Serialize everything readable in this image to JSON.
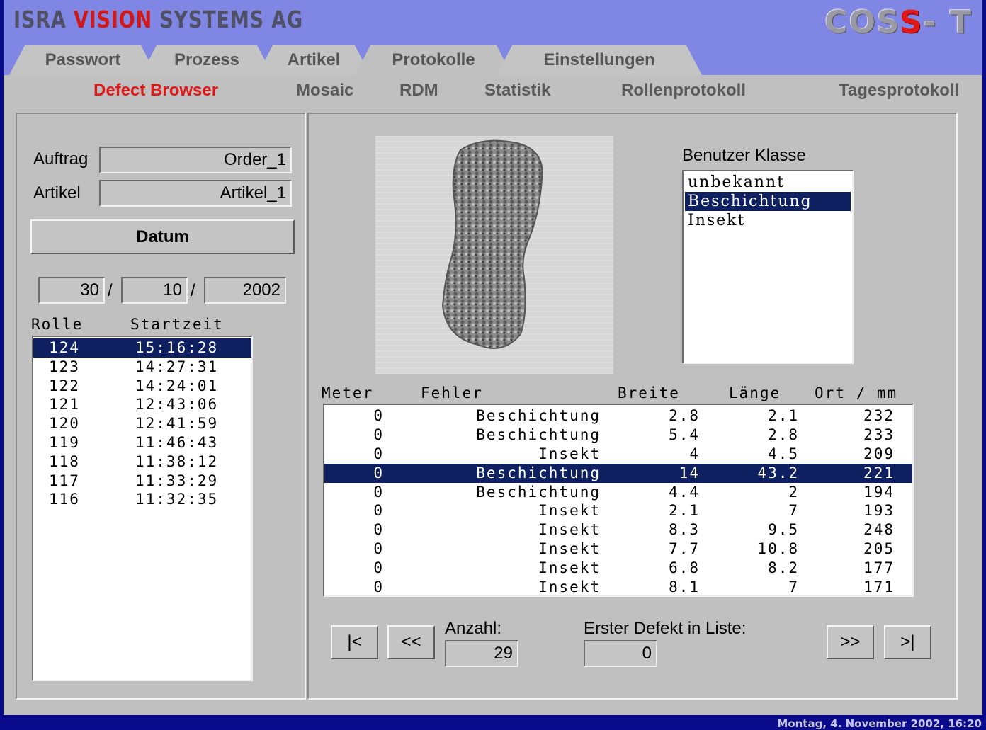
{
  "header": {
    "brand_part1": "ISRA ",
    "brand_part2": "VISION",
    "brand_part3": " SYSTEMS AG",
    "logo_cos": "COS",
    "logo_s": "S",
    "logo_t": "- T"
  },
  "tabs": [
    "Passwort",
    "Prozess",
    "Artikel",
    "Protokolle",
    "Einstellungen"
  ],
  "subnav": [
    "Defect Browser",
    "Mosaic",
    "RDM",
    "Statistik",
    "Rollenprotokoll",
    "Tagesprotokoll"
  ],
  "left": {
    "auftrag_label": "Auftrag",
    "auftrag_value": "Order_1",
    "artikel_label": "Artikel",
    "artikel_value": "Artikel_1",
    "datum_button": "Datum",
    "day": "30",
    "month": "10",
    "year": "2002",
    "sep": "/",
    "col_rolle": "Rolle",
    "col_startzeit": "Startzeit",
    "rolls": [
      {
        "rolle": "124",
        "start": "15:16:28"
      },
      {
        "rolle": "123",
        "start": "14:27:31"
      },
      {
        "rolle": "122",
        "start": "14:24:01"
      },
      {
        "rolle": "121",
        "start": "12:43:06"
      },
      {
        "rolle": "120",
        "start": "12:41:59"
      },
      {
        "rolle": "119",
        "start": "11:46:43"
      },
      {
        "rolle": "118",
        "start": "11:38:12"
      },
      {
        "rolle": "117",
        "start": "11:33:29"
      },
      {
        "rolle": "116",
        "start": "11:32:35"
      }
    ]
  },
  "classes": {
    "title": "Benutzer Klasse",
    "items": [
      "unbekannt",
      "Beschichtung",
      "Insekt"
    ]
  },
  "defects": {
    "headers": {
      "meter": "Meter",
      "fehler": "Fehler",
      "breite": "Breite",
      "laenge": "Länge",
      "ort": "Ort / mm"
    },
    "rows": [
      {
        "m": "0",
        "f": "Beschichtung",
        "b": "2.8",
        "l": "2.1",
        "o": "232"
      },
      {
        "m": "0",
        "f": "Beschichtung",
        "b": "5.4",
        "l": "2.8",
        "o": "233"
      },
      {
        "m": "0",
        "f": "Insekt",
        "b": "4",
        "l": "4.5",
        "o": "209"
      },
      {
        "m": "0",
        "f": "Beschichtung",
        "b": "14",
        "l": "43.2",
        "o": "221"
      },
      {
        "m": "0",
        "f": "Beschichtung",
        "b": "4.4",
        "l": "2",
        "o": "194"
      },
      {
        "m": "0",
        "f": "Insekt",
        "b": "2.1",
        "l": "7",
        "o": "193"
      },
      {
        "m": "0",
        "f": "Insekt",
        "b": "8.3",
        "l": "9.5",
        "o": "248"
      },
      {
        "m": "0",
        "f": "Insekt",
        "b": "7.7",
        "l": "10.8",
        "o": "205"
      },
      {
        "m": "0",
        "f": "Insekt",
        "b": "6.8",
        "l": "8.2",
        "o": "177"
      },
      {
        "m": "0",
        "f": "Insekt",
        "b": "8.1",
        "l": "7",
        "o": "171"
      }
    ]
  },
  "nav": {
    "first": "|<",
    "prev": "<<",
    "next": ">>",
    "last": ">|",
    "anzahl_label": "Anzahl:",
    "anzahl_value": "29",
    "erster_label": "Erster Defekt in Liste:",
    "erster_value": "0"
  },
  "footer": "Montag, 4. November 2002, 16:20"
}
